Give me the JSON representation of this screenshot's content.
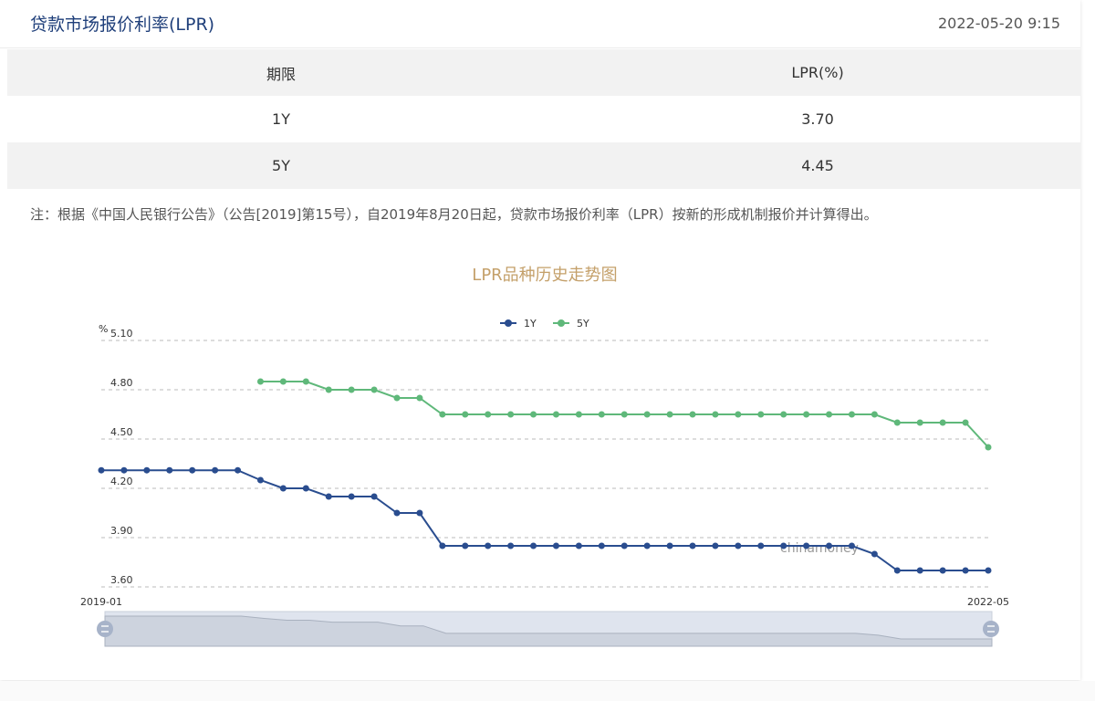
{
  "header": {
    "title": "贷款市场报价利率(LPR)",
    "timestamp": "2022-05-20 9:15"
  },
  "table": {
    "headers": [
      "期限",
      "LPR(%)"
    ],
    "rows": [
      {
        "term": "1Y",
        "rate": "3.70"
      },
      {
        "term": "5Y",
        "rate": "4.45"
      }
    ]
  },
  "note": "注：根据《中国人民银行公告》（公告[2019]第15号），自2019年8月20日起，贷款市场报价利率（LPR）按新的形成机制报价并计算得出。",
  "chart_data": {
    "type": "line",
    "title": "LPR品种历史走势图",
    "ylabel": "%",
    "ylim": [
      3.6,
      5.1
    ],
    "yticks": [
      "5.10",
      "4.80",
      "4.50",
      "4.20",
      "3.90",
      "3.60"
    ],
    "xlim_labels": [
      "2019-01",
      "2022-05"
    ],
    "legend_position": "top-center",
    "grid": true,
    "watermark": "chinamoney",
    "series": [
      {
        "name": "1Y",
        "color": "#2a4d8f",
        "values": [
          4.31,
          4.31,
          4.31,
          4.31,
          4.31,
          4.31,
          4.31,
          4.25,
          4.2,
          4.2,
          4.15,
          4.15,
          4.15,
          4.05,
          4.05,
          3.85,
          3.85,
          3.85,
          3.85,
          3.85,
          3.85,
          3.85,
          3.85,
          3.85,
          3.85,
          3.85,
          3.85,
          3.85,
          3.85,
          3.85,
          3.85,
          3.85,
          3.85,
          3.85,
          3.8,
          3.7,
          3.7,
          3.7,
          3.7,
          3.7
        ]
      },
      {
        "name": "5Y",
        "color": "#5fb87a",
        "values": [
          null,
          null,
          null,
          null,
          null,
          null,
          null,
          4.85,
          4.85,
          4.85,
          4.8,
          4.8,
          4.8,
          4.75,
          4.75,
          4.65,
          4.65,
          4.65,
          4.65,
          4.65,
          4.65,
          4.65,
          4.65,
          4.65,
          4.65,
          4.65,
          4.65,
          4.65,
          4.65,
          4.65,
          4.65,
          4.65,
          4.65,
          4.65,
          4.65,
          4.6,
          4.6,
          4.6,
          4.6,
          4.45
        ]
      }
    ]
  }
}
